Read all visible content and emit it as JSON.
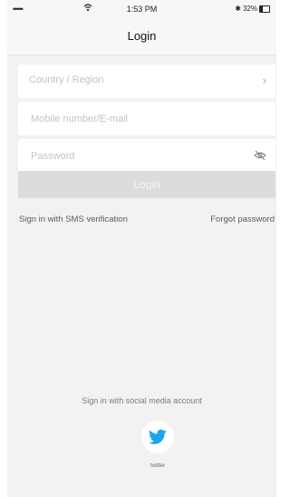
{
  "status_bar": {
    "signal": "•••••",
    "time": "1:53 PM",
    "battery": "32%",
    "battery_level": 0.32
  },
  "nav": {
    "title": "Login"
  },
  "form": {
    "country_placeholder": "Country / Region",
    "account_placeholder": "Mobile number/E-mail",
    "password_placeholder": "Password",
    "login_label": "Login"
  },
  "links": {
    "sms": "Sign in with SMS verification",
    "forgot": "Forgot password"
  },
  "social": {
    "label": "Sign in with social media account",
    "twitter_label": "twitter",
    "twitter_color": "#1da1f2"
  },
  "icons": {
    "wifi": "wifi-icon",
    "battery": "battery-icon",
    "chevron": "chevron-right-icon",
    "eye": "eye-off-icon",
    "twitter": "twitter-bird-icon"
  }
}
